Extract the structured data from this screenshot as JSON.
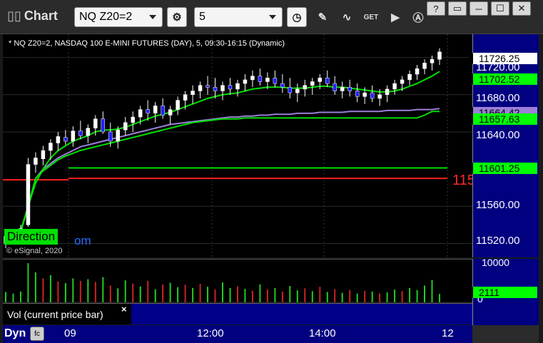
{
  "window": {
    "title": "Chart",
    "symbol": "NQ Z20=2",
    "interval": "5",
    "buttons": {
      "help": "?",
      "restore": "▭",
      "minimize": "─",
      "maximize": "☐",
      "close": "✕"
    }
  },
  "chart": {
    "title": "* NQ Z20=2, NASDAQ 100 E-MINI FUTURES (DAY), 5, 09:30-16:15 (Dynamic)",
    "copyright": "© eSignal, 2020",
    "overlay_label": "Direction",
    "overlay_url": "om",
    "red_edge_text": "115"
  },
  "colors": {
    "background": "#000000",
    "axis": "#000080",
    "up_candle": "#ffffff",
    "down_candle": "#2222ff",
    "ma_green": "#00e000",
    "ma_purple": "#9b7fd8",
    "red_line": "#ff2020",
    "vol_green": "#22cc22",
    "vol_red": "#cc2222"
  },
  "price_axis": {
    "ticks": [
      "11720.00",
      "11680.00",
      "11640.00",
      "11560.00",
      "11520.00"
    ],
    "tags": [
      {
        "label": "11726.25",
        "bg": "#ffffff"
      },
      {
        "label": "11702.52",
        "bg": "#00ff00"
      },
      {
        "label": "11664.42",
        "bg": "#9b7fd8"
      },
      {
        "label": "11657.63",
        "bg": "#00ff00"
      },
      {
        "label": "11601.25",
        "bg": "#00ff00"
      }
    ]
  },
  "volume": {
    "label": "Vol (current price bar)",
    "close_glyph": "×",
    "ticks": [
      "10000",
      "0"
    ],
    "tag": "2111"
  },
  "time_axis": {
    "dyn": "Dyn",
    "fc": "fc",
    "labels": [
      "09",
      "12:00",
      "14:00",
      "12"
    ]
  },
  "chart_data": {
    "type": "candlestick",
    "title": "* NQ Z20=2, NASDAQ 100 E-MINI FUTURES (DAY), 5, 09:30-16:15 (Dynamic)",
    "y_ticks": [
      11720,
      11680,
      11640,
      11560,
      11520
    ],
    "ylim": [
      11505,
      11745
    ],
    "x_ticks": [
      "09",
      "12:00",
      "14:00",
      "12"
    ],
    "levels": [
      {
        "name": "11601.25",
        "value": 11601.25,
        "color": "#00ff00"
      },
      {
        "name": "red",
        "value": 11590,
        "color": "#ff2020"
      }
    ],
    "candles": [
      [
        11520,
        11532,
        11515,
        11528
      ],
      [
        11527,
        11535,
        11522,
        11530
      ],
      [
        11529,
        11540,
        11525,
        11536
      ],
      [
        11540,
        11612,
        11538,
        11605
      ],
      [
        11605,
        11618,
        11596,
        11612
      ],
      [
        11611,
        11625,
        11604,
        11620
      ],
      [
        11620,
        11632,
        11610,
        11628
      ],
      [
        11628,
        11640,
        11620,
        11635
      ],
      [
        11634,
        11642,
        11626,
        11630
      ],
      [
        11630,
        11646,
        11624,
        11641
      ],
      [
        11641,
        11652,
        11632,
        11636
      ],
      [
        11636,
        11648,
        11628,
        11644
      ],
      [
        11644,
        11658,
        11636,
        11654
      ],
      [
        11654,
        11662,
        11638,
        11640
      ],
      [
        11640,
        11650,
        11624,
        11630
      ],
      [
        11630,
        11646,
        11622,
        11642
      ],
      [
        11642,
        11656,
        11636,
        11650
      ],
      [
        11650,
        11662,
        11640,
        11656
      ],
      [
        11656,
        11668,
        11648,
        11664
      ],
      [
        11664,
        11674,
        11652,
        11660
      ],
      [
        11660,
        11672,
        11650,
        11668
      ],
      [
        11668,
        11676,
        11654,
        11658
      ],
      [
        11658,
        11668,
        11648,
        11664
      ],
      [
        11664,
        11678,
        11658,
        11674
      ],
      [
        11674,
        11684,
        11664,
        11680
      ],
      [
        11680,
        11690,
        11670,
        11684
      ],
      [
        11684,
        11694,
        11676,
        11690
      ],
      [
        11690,
        11700,
        11680,
        11688
      ],
      [
        11688,
        11698,
        11676,
        11684
      ],
      [
        11684,
        11694,
        11674,
        11690
      ],
      [
        11690,
        11698,
        11680,
        11686
      ],
      [
        11686,
        11696,
        11678,
        11692
      ],
      [
        11692,
        11702,
        11684,
        11696
      ],
      [
        11696,
        11706,
        11688,
        11700
      ],
      [
        11700,
        11708,
        11690,
        11694
      ],
      [
        11694,
        11704,
        11686,
        11698
      ],
      [
        11698,
        11706,
        11688,
        11692
      ],
      [
        11692,
        11702,
        11682,
        11688
      ],
      [
        11688,
        11698,
        11676,
        11682
      ],
      [
        11682,
        11692,
        11672,
        11686
      ],
      [
        11686,
        11696,
        11678,
        11690
      ],
      [
        11690,
        11698,
        11680,
        11694
      ],
      [
        11694,
        11702,
        11686,
        11698
      ],
      [
        11698,
        11706,
        11688,
        11692
      ],
      [
        11692,
        11700,
        11680,
        11684
      ],
      [
        11684,
        11694,
        11676,
        11688
      ],
      [
        11688,
        11696,
        11678,
        11684
      ],
      [
        11684,
        11692,
        11672,
        11678
      ],
      [
        11678,
        11688,
        11670,
        11682
      ],
      [
        11682,
        11690,
        11672,
        11676
      ],
      [
        11676,
        11686,
        11668,
        11680
      ],
      [
        11680,
        11690,
        11672,
        11686
      ],
      [
        11686,
        11696,
        11680,
        11692
      ],
      [
        11692,
        11700,
        11684,
        11696
      ],
      [
        11696,
        11706,
        11690,
        11702
      ],
      [
        11702,
        11712,
        11696,
        11708
      ],
      [
        11708,
        11718,
        11702,
        11714
      ],
      [
        11714,
        11722,
        11706,
        11718
      ],
      [
        11718,
        11730,
        11712,
        11726
      ]
    ],
    "ma_green_fast": [
      11528,
      11530,
      11534,
      11560,
      11585,
      11600,
      11612,
      11620,
      11625,
      11630,
      11633,
      11636,
      11640,
      11642,
      11642,
      11643,
      11645,
      11648,
      11651,
      11654,
      11657,
      11659,
      11661,
      11664,
      11667,
      11670,
      11673,
      11676,
      11678,
      11680,
      11681,
      11682,
      11684,
      11686,
      11687,
      11688,
      11688,
      11688,
      11687,
      11687,
      11687,
      11688,
      11689,
      11689,
      11688,
      11688,
      11687,
      11686,
      11685,
      11684,
      11683,
      11683,
      11684,
      11686,
      11689,
      11692,
      11696,
      11700,
      11705
    ],
    "ma_purple": [
      11528,
      11530,
      11532,
      11560,
      11590,
      11600,
      11606,
      11612,
      11616,
      11620,
      11624,
      11626,
      11628,
      11630,
      11632,
      11634,
      11636,
      11638,
      11640,
      11642,
      11644,
      11646,
      11648,
      11649,
      11650,
      11651,
      11652,
      11653,
      11654,
      11655,
      11656,
      11656,
      11657,
      11657,
      11658,
      11658,
      11659,
      11659,
      11659,
      11660,
      11660,
      11660,
      11661,
      11661,
      11661,
      11661,
      11662,
      11662,
      11662,
      11662,
      11662,
      11663,
      11663,
      11663,
      11663,
      11664,
      11664,
      11664,
      11665
    ],
    "ma_green_slow": [
      11528,
      11530,
      11532,
      11560,
      11590,
      11598,
      11604,
      11610,
      11614,
      11617,
      11620,
      11622,
      11624,
      11626,
      11628,
      11630,
      11632,
      11634,
      11636,
      11638,
      11640,
      11642,
      11644,
      11646,
      11648,
      11650,
      11651,
      11652,
      11653,
      11654,
      11654,
      11654,
      11655,
      11655,
      11655,
      11655,
      11655,
      11655,
      11655,
      11655,
      11655,
      11655,
      11655,
      11655,
      11655,
      11655,
      11655,
      11655,
      11655,
      11655,
      11655,
      11655,
      11655,
      11655,
      11655,
      11655,
      11658,
      11662,
      11662
    ],
    "volume": [
      2600,
      2200,
      2700,
      9800,
      7500,
      6000,
      6800,
      5200,
      4800,
      6000,
      5400,
      5800,
      5100,
      6300,
      4200,
      3500,
      5500,
      4700,
      4000,
      5400,
      3300,
      4500,
      4900,
      3800,
      4400,
      3600,
      4600,
      3900,
      3200,
      5000,
      3600,
      4000,
      3400,
      2900,
      4500,
      3200,
      3600,
      2700,
      4100,
      3000,
      3500,
      2800,
      3900,
      2600,
      3300,
      2400,
      3100,
      2200,
      2900,
      2700,
      2200,
      2500,
      3200,
      2800,
      3600,
      3100,
      4200,
      5600,
      2111
    ],
    "volume_up": [
      1,
      1,
      1,
      1,
      1,
      0,
      1,
      0,
      1,
      1,
      0,
      1,
      0,
      1,
      0,
      1,
      1,
      0,
      1,
      0,
      1,
      0,
      1,
      1,
      0,
      1,
      0,
      1,
      0,
      1,
      1,
      0,
      1,
      0,
      1,
      0,
      1,
      0,
      1,
      1,
      0,
      1,
      0,
      1,
      0,
      1,
      0,
      1,
      0,
      1,
      0,
      1,
      1,
      0,
      1,
      1,
      1,
      1,
      1
    ]
  }
}
